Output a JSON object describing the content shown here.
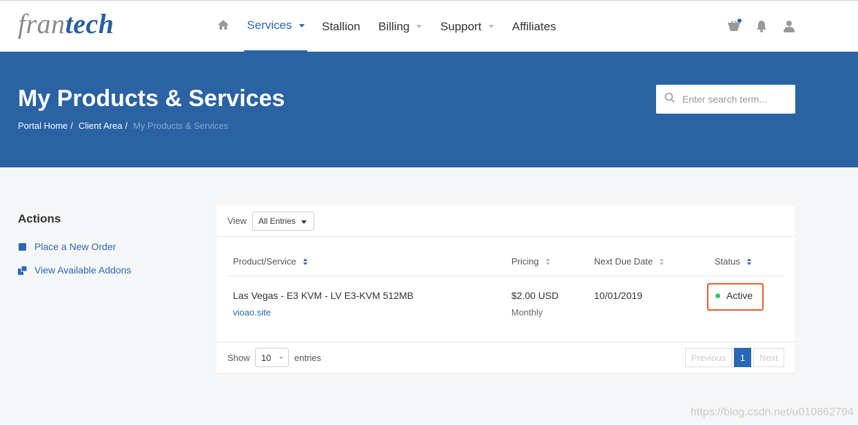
{
  "brand": {
    "logo_part1": "fran",
    "logo_part2": "tech"
  },
  "nav": {
    "home_icon": "home-icon",
    "items": [
      {
        "label": "Services",
        "active": true,
        "dropdown": true
      },
      {
        "label": "Stallion",
        "active": false,
        "dropdown": false
      },
      {
        "label": "Billing",
        "active": false,
        "dropdown": true
      },
      {
        "label": "Support",
        "active": false,
        "dropdown": true
      },
      {
        "label": "Affiliates",
        "active": false,
        "dropdown": false
      }
    ],
    "icons": [
      "cart-icon",
      "bell-icon",
      "user-icon"
    ]
  },
  "header": {
    "title": "My Products & Services",
    "breadcrumb": [
      "Portal Home",
      "Client Area",
      "My Products & Services"
    ],
    "search_placeholder": "Enter search term..."
  },
  "sidebar": {
    "title": "Actions",
    "links": [
      {
        "label": "Place a New Order",
        "icon": "order-icon"
      },
      {
        "label": "View Available Addons",
        "icon": "addons-icon"
      }
    ]
  },
  "table": {
    "view_label": "View",
    "view_value": "All Entries",
    "columns": [
      "Product/Service",
      "Pricing",
      "Next Due Date",
      "Status"
    ],
    "rows": [
      {
        "product": "Las Vegas - E3 KVM - LV E3-KVM 512MB",
        "domain": "vioao.site",
        "price": "$2.00 USD",
        "cycle": "Monthly",
        "due": "10/01/2019",
        "status": "Active"
      }
    ],
    "show_label": "Show",
    "show_value": "10",
    "entries_label": "entries",
    "pagination": {
      "previous": "Previous",
      "current": "1",
      "next": "Next"
    }
  },
  "colors": {
    "brand_blue": "#2a62a4",
    "link_blue": "#2a67b5",
    "status_active": "#3cbf5a",
    "highlight": "#e85a2b"
  },
  "watermark": "https://blog.csdn.net/u010862794"
}
